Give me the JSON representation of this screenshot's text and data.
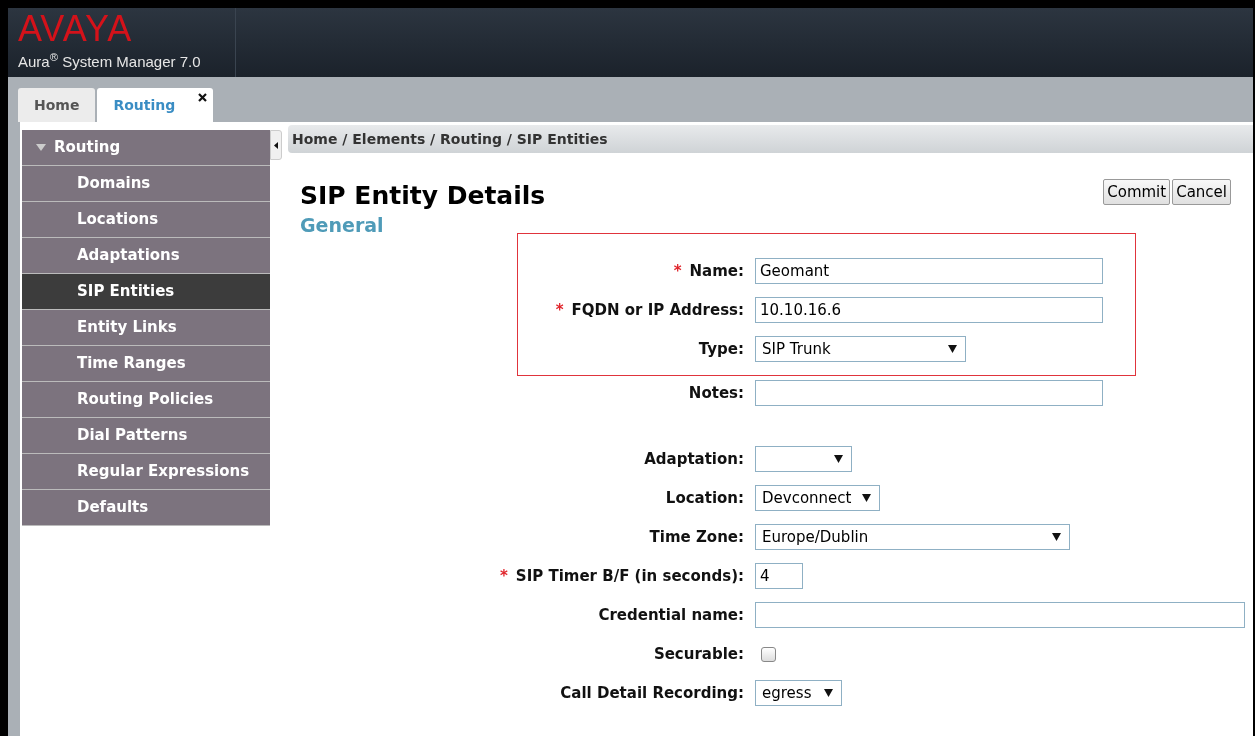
{
  "header": {
    "logo": "AVAYA",
    "product": "Aura$^{®}$ System Manager 7.0"
  },
  "tabs": [
    {
      "label": "Home",
      "selected": false,
      "closable": false
    },
    {
      "label": "Routing",
      "selected": true,
      "closable": true
    }
  ],
  "sidebar": {
    "title": "Routing",
    "expanded": true,
    "items": [
      {
        "label": "Domains",
        "selected": false
      },
      {
        "label": "Locations",
        "selected": false
      },
      {
        "label": "Adaptations",
        "selected": false
      },
      {
        "label": "SIP Entities",
        "selected": true
      },
      {
        "label": "Entity Links",
        "selected": false
      },
      {
        "label": "Time Ranges",
        "selected": false
      },
      {
        "label": "Routing Policies",
        "selected": false
      },
      {
        "label": "Dial Patterns",
        "selected": false
      },
      {
        "label": "Regular Expressions",
        "selected": false
      },
      {
        "label": "Defaults",
        "selected": false
      }
    ]
  },
  "breadcrumb": "Home / Elements / Routing / SIP Entities",
  "page_title": "SIP Entity Details",
  "buttons": [
    "Commit",
    "Cancel"
  ],
  "section": "General",
  "highlighted_fields": [
    {
      "kind": "text",
      "required_mark": "*",
      "label": "Name:",
      "value": "Geomant"
    },
    {
      "kind": "text",
      "required_mark": "*",
      "label": "FQDN or IP Address:",
      "value": "10.10.16.6"
    },
    {
      "kind": "select",
      "label": "Type:",
      "value": "SIP Trunk"
    }
  ],
  "fields": [
    {
      "kind": "text",
      "label": "Notes:"
    },
    {
      "kind": "select",
      "label": "Adaptation:"
    },
    {
      "kind": "select",
      "label": "Location:",
      "value": "Devconnect"
    },
    {
      "kind": "select",
      "label": "Time Zone:",
      "value": "Europe/Dublin"
    },
    {
      "kind": "text",
      "required_mark": "*",
      "label": "SIP Timer B/F (in seconds):",
      "value": "4"
    },
    {
      "kind": "text",
      "label": "Credential name:"
    },
    {
      "kind": "checkbox",
      "label": "Securable:",
      "checked": false
    },
    {
      "kind": "select",
      "label": "Call Detail Recording:",
      "value": "egress"
    }
  ]
}
